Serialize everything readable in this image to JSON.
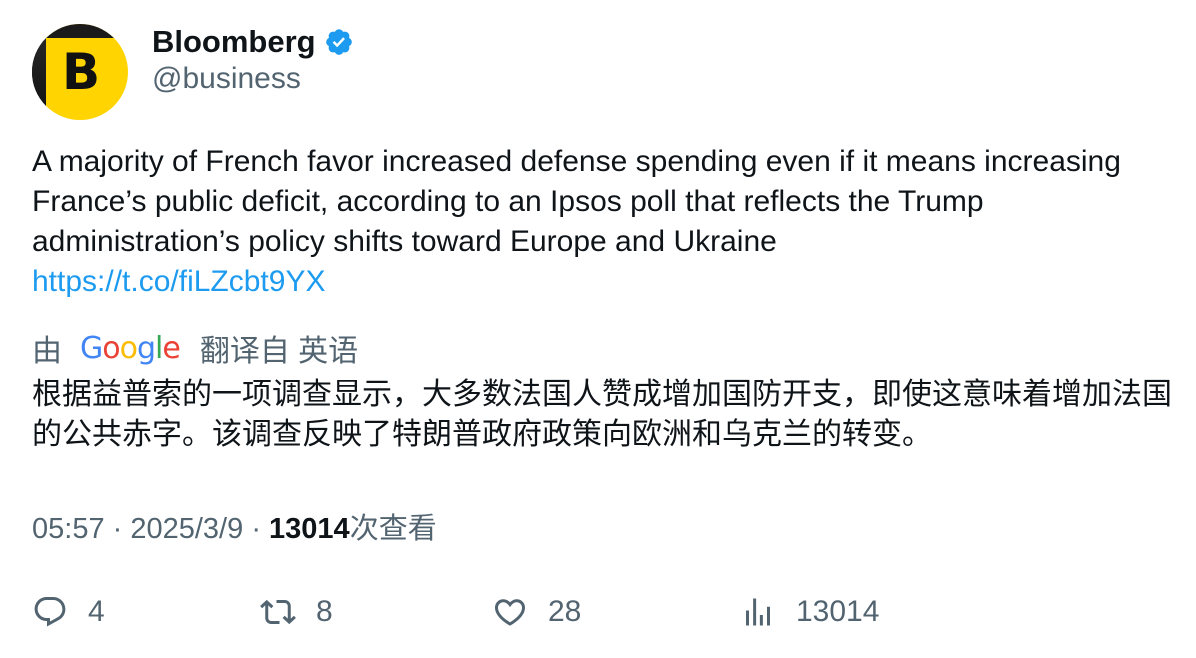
{
  "author": {
    "name": "Bloomberg",
    "handle": "@business",
    "avatar_letter": "B",
    "verified": true,
    "avatar_colors": {
      "background": "#ffd400",
      "edge": "#1b1b1b"
    }
  },
  "tweet": {
    "text": "A majority of French favor increased defense spending even if it means increasing France’s public deficit, according to an Ipsos poll that reflects the Trump administration’s policy shifts toward Europe and Ukraine",
    "link": "https://t.co/fiLZcbt9YX"
  },
  "translation": {
    "by_label": "由",
    "provider_logo": "Google",
    "from_label": "翻译自 英语",
    "text": "根据益普索的一项调查显示，大多数法国人赞成增加国防开支，即使这意味着增加法国的公共赤字。该调查反映了特朗普政府政策向欧洲和乌克兰的转变。"
  },
  "meta": {
    "time": "05:57",
    "separator": "·",
    "date": "2025/3/9",
    "views_count": "13014",
    "views_label": "次查看"
  },
  "actions": {
    "replies": "4",
    "retweets": "8",
    "likes": "28",
    "views": "13014"
  },
  "colors": {
    "text": "#0f1419",
    "secondary": "#536471",
    "link": "#1d9bf0",
    "verified": "#1d9bf0"
  }
}
